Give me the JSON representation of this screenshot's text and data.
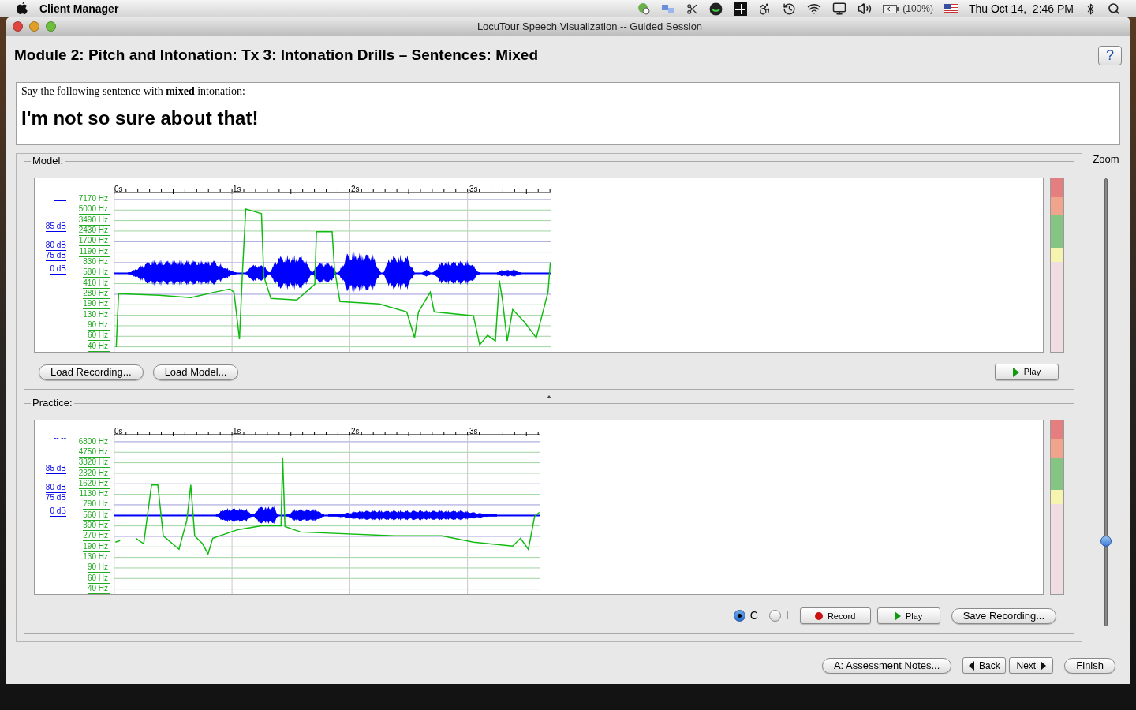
{
  "menubar": {
    "app_name": "Client Manager",
    "battery": "(100%)",
    "clock": "Thu Oct 14,  2:46 PM"
  },
  "window": {
    "title": "LocuTour Speech Visualization -- Guided Session"
  },
  "heading": "Module 2: Pitch and Intonation: Tx 3: Intonation Drills – Sentences: Mixed",
  "help_button": "?",
  "prompt": {
    "instruction": "Say the following sentence with **mixed** intonation:",
    "sentence": "I'm not so sure about that!"
  },
  "model": {
    "label": "Model:",
    "db_labels": [
      "-- --",
      "85 dB",
      "80 dB",
      "75 dB",
      "0 dB"
    ],
    "hz_labels": [
      "7170 Hz",
      "5000 Hz",
      "3490 Hz",
      "2430 Hz",
      "1700 Hz",
      "1190 Hz",
      "830 Hz",
      "580 Hz",
      "410 Hz",
      "280 Hz",
      "190 Hz",
      "130 Hz",
      "90 Hz",
      "60 Hz",
      "40 Hz"
    ],
    "time_labels": [
      "0s",
      "1s",
      "2s",
      "3s"
    ],
    "buttons": [
      "Load Recording...",
      "Load Model..."
    ],
    "play": "Play"
  },
  "practice": {
    "label": "Practice:",
    "db_labels": [
      "-- --",
      "85 dB",
      "80 dB",
      "75 dB",
      "0 dB"
    ],
    "hz_labels": [
      "6800 Hz",
      "4750 Hz",
      "3320 Hz",
      "2320 Hz",
      "1620 Hz",
      "1130 Hz",
      "790 Hz",
      "560 Hz",
      "390 Hz",
      "270 Hz",
      "190 Hz",
      "130 Hz",
      "90 Hz",
      "60 Hz",
      "40 Hz"
    ],
    "time_labels": [
      "0s",
      "1s",
      "2s",
      "3s"
    ],
    "radios": [
      {
        "label": "C",
        "selected": true
      },
      {
        "label": "I",
        "selected": false
      }
    ],
    "record": "Record",
    "play": "Play",
    "save": "Save Recording..."
  },
  "zoom": {
    "label": "Zoom",
    "level": 0.19
  },
  "footer": {
    "notes": "A: Assessment Notes...",
    "back": "Back",
    "next": "Next",
    "finish": "Finish"
  }
}
